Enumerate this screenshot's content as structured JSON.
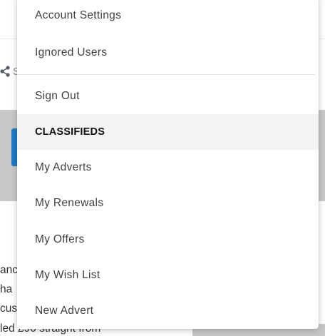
{
  "background": {
    "share_label": "S",
    "partial_text_lines": [
      "anc",
      " ha",
      "cust",
      "led £90 straight from"
    ]
  },
  "menu": {
    "account_settings": "Account Settings",
    "ignored_users": "Ignored Users",
    "sign_out": "Sign Out",
    "classifieds_header": "CLASSIFIEDS",
    "my_adverts": "My Adverts",
    "my_renewals": "My Renewals",
    "my_offers": "My Offers",
    "my_wish_list": "My Wish List",
    "new_advert": "New Advert"
  },
  "colors": {
    "accent_blue": "#1e7bc6",
    "section_bg": "#f3f3f3",
    "overlay_gray": "#c8c8c8"
  }
}
